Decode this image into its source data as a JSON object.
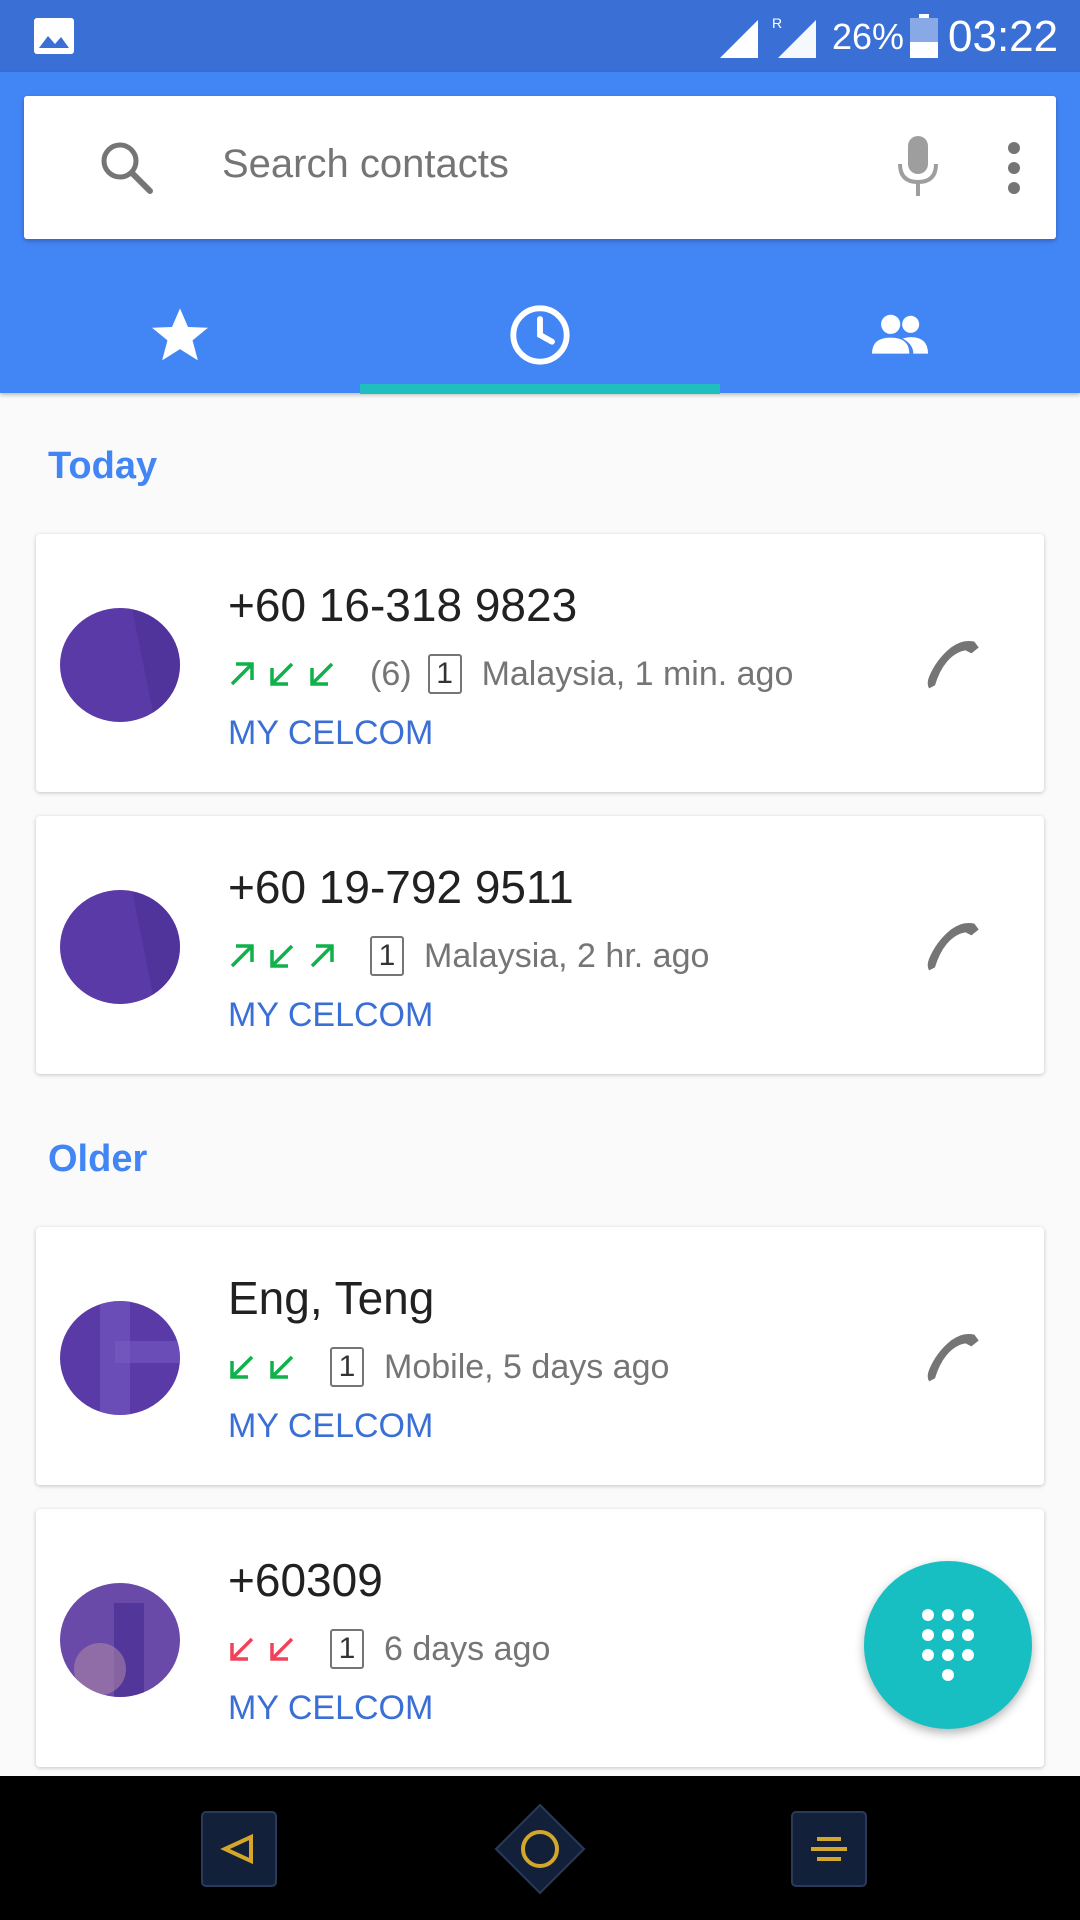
{
  "status_bar": {
    "battery_percent": "26%",
    "time": "03:22",
    "roaming_label": "R",
    "icons": [
      "image-notification-icon",
      "signal-icon",
      "roaming-signal-icon",
      "battery-icon"
    ]
  },
  "search": {
    "placeholder": "Search contacts",
    "icons": [
      "search-icon",
      "mic-icon",
      "more-vert-icon"
    ]
  },
  "tabs": [
    {
      "name": "favorites",
      "icon": "star-icon",
      "selected": false
    },
    {
      "name": "recents",
      "icon": "clock-icon",
      "selected": true
    },
    {
      "name": "contacts",
      "icon": "people-icon",
      "selected": false
    }
  ],
  "sections": {
    "today": "Today",
    "older": "Older"
  },
  "calls": [
    {
      "name": "+60 16-318 9823",
      "arrows": [
        "outgoing",
        "incoming",
        "incoming"
      ],
      "count": "(6)",
      "sim": "1",
      "detail": "Malaysia, 1 min. ago",
      "carrier": "MY CELCOM"
    },
    {
      "name": "+60 19-792 9511",
      "arrows": [
        "outgoing",
        "incoming",
        "outgoing"
      ],
      "count": "",
      "sim": "1",
      "detail": "Malaysia, 2 hr. ago",
      "carrier": "MY CELCOM"
    },
    {
      "name": "Eng, Teng",
      "arrows": [
        "incoming",
        "incoming"
      ],
      "count": "",
      "sim": "1",
      "detail": "Mobile, 5 days ago",
      "carrier": "MY CELCOM"
    },
    {
      "name": "+60309",
      "arrows": [
        "missed",
        "missed"
      ],
      "count": "",
      "sim": "1",
      "detail": "6 days ago",
      "carrier": "MY CELCOM"
    }
  ],
  "colors": {
    "status_bar": "#3a6fd6",
    "header": "#4285f4",
    "tab_indicator": "#1fbfbf",
    "incoming_arrow": "#0fb24a",
    "missed_arrow": "#f0435a",
    "avatar": "#5a3aa6",
    "fab": "#18bfc2",
    "carrier_text": "#3a6fd6"
  },
  "fab": {
    "icon": "dialpad-icon"
  },
  "nav_bar": {
    "icons": [
      "back-icon",
      "home-icon",
      "recents-icon"
    ]
  }
}
